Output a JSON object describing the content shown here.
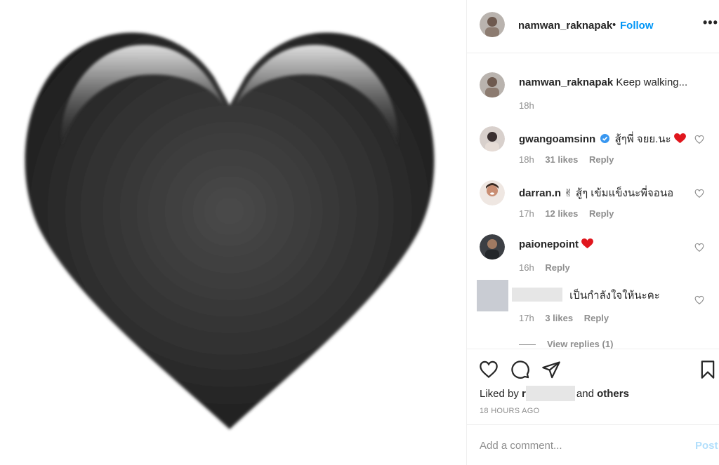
{
  "post": {
    "author": "namwan_raknapak",
    "separator": "•",
    "follow_label": "Follow",
    "more_label": "•••",
    "image_icon": "black-heart"
  },
  "comments": [
    {
      "user": "namwan_raknapak",
      "text": "Keep walking...",
      "time": "18h"
    },
    {
      "user": "gwangoamsinn",
      "verified": true,
      "text": "สู้ๆพี่ จยย.นะ",
      "time": "18h",
      "likes": "31 likes",
      "reply": "Reply"
    },
    {
      "user": "darran.n",
      "text": "✌ สู้ๆ เข้มแข็งนะพี่จอนอ",
      "time": "17h",
      "likes": "12 likes",
      "reply": "Reply"
    },
    {
      "user": "paionepoint",
      "text": "",
      "time": "16h",
      "reply": "Reply"
    },
    {
      "user": "",
      "text": "เป็นกำลังใจให้นะคะ",
      "time": "17h",
      "likes": "3 likes",
      "reply": "Reply"
    }
  ],
  "view_replies": "View replies (1)",
  "actions": {
    "like_icon": "heart-outline",
    "comment_icon": "speech-bubble",
    "share_icon": "paper-plane",
    "save_icon": "bookmark"
  },
  "liked_by": {
    "prefix": "Liked by",
    "user_visible": "r",
    "and": "and",
    "others": "others"
  },
  "posted_ago": "18 HOURS AGO",
  "add_comment": {
    "placeholder": "Add a comment...",
    "post_label": "Post"
  },
  "colors": {
    "accent": "#0095f6",
    "muted": "#8e8e8e",
    "post_disabled": "#b2dffc",
    "red_heart": "#e0161d"
  }
}
